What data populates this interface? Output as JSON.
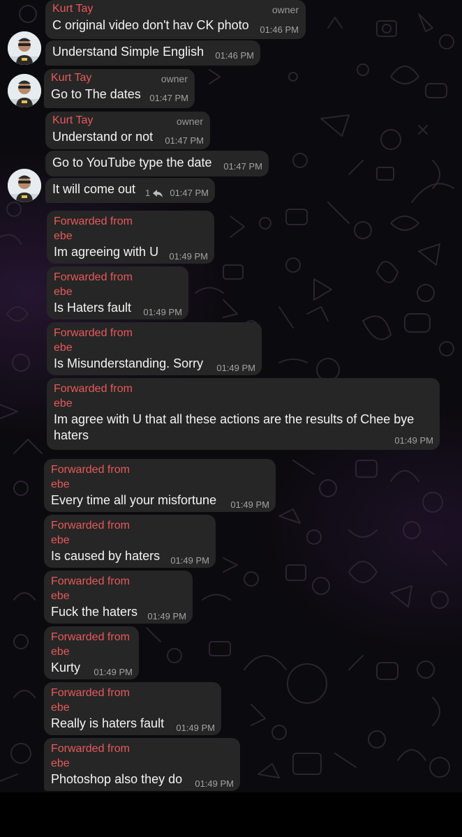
{
  "accent": "#e8595a",
  "bubble_color": "#262626",
  "messages": [
    {
      "id": "m1",
      "sender": "Kurt Tay",
      "role": "owner",
      "text": "C original video don't hav CK photo",
      "time": "01:46 PM"
    },
    {
      "id": "m2",
      "text": "Understand Simple English",
      "time": "01:46 PM"
    },
    {
      "id": "m3",
      "sender": "Kurt Tay",
      "role": "owner",
      "text": "Go to The dates",
      "time": "01:47 PM"
    },
    {
      "id": "m4",
      "sender": "Kurt Tay",
      "role": "owner",
      "text": "Understand or not",
      "time": "01:47 PM"
    },
    {
      "id": "m5",
      "text": "Go to YouTube type the date",
      "time": "01:47 PM"
    },
    {
      "id": "m6",
      "text": "It will come out",
      "replies": "1",
      "time": "01:47 PM"
    },
    {
      "id": "f1",
      "forwarded": "Forwarded from",
      "from": "ebe",
      "text": "Im agreeing with U",
      "time": "01:49 PM"
    },
    {
      "id": "f2",
      "forwarded": "Forwarded from",
      "from": "ebe",
      "text": "Is Haters fault",
      "time": "01:49 PM"
    },
    {
      "id": "f3",
      "forwarded": "Forwarded from",
      "from": "ebe",
      "text": "Is Misunderstanding. Sorry",
      "time": "01:49 PM"
    },
    {
      "id": "f4",
      "forwarded": "Forwarded from",
      "from": "ebe",
      "text": "Im agree with U that all these actions are the results of Chee bye haters",
      "time": "01:49 PM"
    },
    {
      "id": "f5",
      "forwarded": "Forwarded from",
      "from": "ebe",
      "text": "Every time all your misfortune",
      "time": "01:49 PM"
    },
    {
      "id": "f6",
      "forwarded": "Forwarded from",
      "from": "ebe",
      "text": "Is caused by haters",
      "time": "01:49 PM"
    },
    {
      "id": "f7",
      "forwarded": "Forwarded from",
      "from": "ebe",
      "text": "Fuck the haters",
      "time": "01:49 PM"
    },
    {
      "id": "f8",
      "forwarded": "Forwarded from",
      "from": "ebe",
      "text": "Kurty",
      "time": "01:49 PM"
    },
    {
      "id": "f9",
      "forwarded": "Forwarded from",
      "from": "ebe",
      "text": "Really is haters fault",
      "time": "01:49 PM"
    },
    {
      "id": "f10",
      "forwarded": "Forwarded from",
      "from": "ebe",
      "text": "Photoshop also they do",
      "time": "01:49 PM"
    }
  ]
}
